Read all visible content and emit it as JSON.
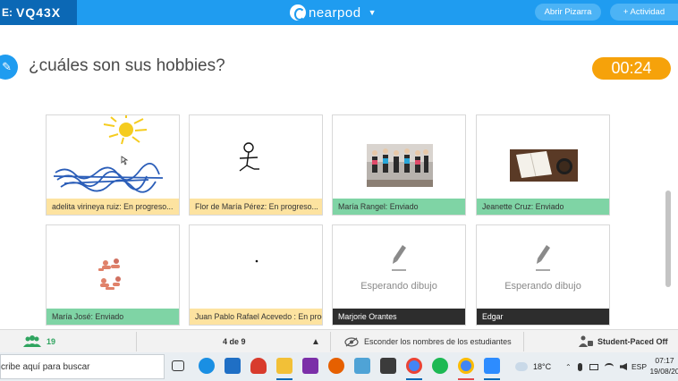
{
  "header": {
    "code_prefix": "E:",
    "session_code": "VQ43X",
    "logo_text": "nearpod",
    "open_board_label": "Abrir Pizarra",
    "add_activity_label": "+ Actividad"
  },
  "question": {
    "text": "¿cuáles son sus hobbies?",
    "timer": "00:24"
  },
  "responses": [
    {
      "label": "adelita virineya ruiz: En progreso...",
      "status": "in-progress"
    },
    {
      "label": "Flor de María Pérez: En progreso...",
      "status": "in-progress"
    },
    {
      "label": "María Rangel: Enviado",
      "status": "sent"
    },
    {
      "label": "Jeanette Cruz: Enviado",
      "status": "sent"
    },
    {
      "label": "María José: Enviado",
      "status": "sent"
    },
    {
      "label": "Juan Pablo Rafael Acevedo : En progreso...",
      "status": "in-progress"
    },
    {
      "label": "Marjorie Orantes",
      "status": "waiting",
      "waiting_text": "Esperando dibujo"
    },
    {
      "label": "Edgar",
      "status": "waiting",
      "waiting_text": "Esperando dibujo"
    }
  ],
  "toolbar": {
    "students_count": "19",
    "pager": "4 de 9",
    "hide_names_label": "Esconder los nombres de los estudiantes",
    "student_paced_label": "Student-Paced Off"
  },
  "taskbar": {
    "search_placeholder": "cribe aquí para buscar",
    "temperature": "18°C",
    "language": "ESP",
    "time": "07:17",
    "date": "19/08/20"
  },
  "colors": {
    "brand_blue": "#1f9cf0",
    "dark_blue": "#0b68b5",
    "timer_orange": "#f6a20a",
    "in_progress": "#fde3a0",
    "sent": "#7fd4a5",
    "waiting": "#2d2d2d"
  }
}
